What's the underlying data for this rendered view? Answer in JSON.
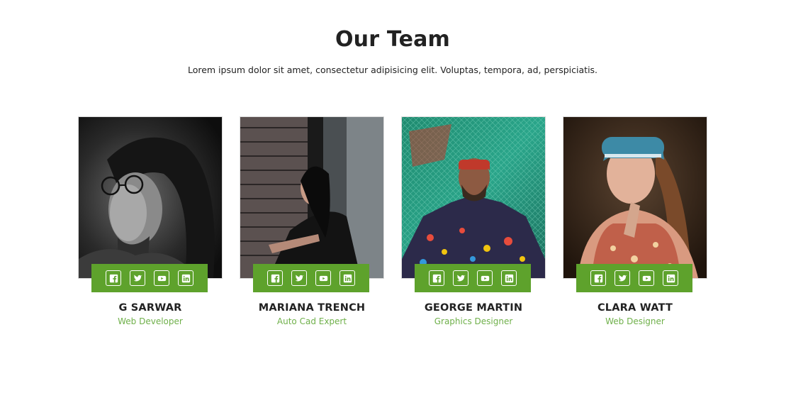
{
  "section": {
    "title": "Our Team",
    "subtitle": "Lorem ipsum dolor sit amet, consectetur adipisicing elit. Voluptas, tempora, ad, perspiciatis."
  },
  "social_icons": [
    "facebook-icon",
    "twitter-icon",
    "youtube-icon",
    "linkedin-icon"
  ],
  "colors": {
    "accent": "#5ea22c",
    "role_text": "#6fb04a",
    "heading": "#222222"
  },
  "team": [
    {
      "name": "G SARWAR",
      "role": "Web Developer"
    },
    {
      "name": "MARIANA TRENCH",
      "role": "Auto Cad Expert"
    },
    {
      "name": "GEORGE MARTIN",
      "role": "Graphics Designer"
    },
    {
      "name": "CLARA WATT",
      "role": "Web Designer"
    }
  ]
}
